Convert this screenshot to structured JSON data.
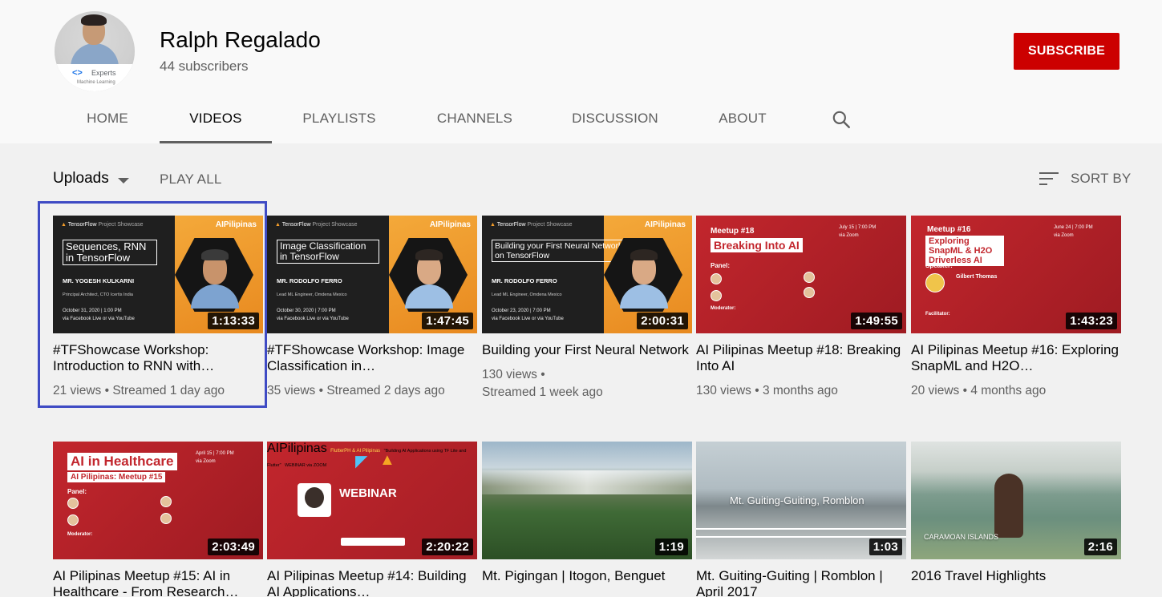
{
  "channel": {
    "name": "Ralph Regalado",
    "subscribers": "44 subscribers",
    "subscribe_label": "SUBSCRIBE",
    "avatar_badge": "Experts",
    "avatar_badge_sub": "Machine Learning"
  },
  "tabs": [
    {
      "label": "HOME"
    },
    {
      "label": "VIDEOS",
      "active": true
    },
    {
      "label": "PLAYLISTS"
    },
    {
      "label": "CHANNELS"
    },
    {
      "label": "DISCUSSION"
    },
    {
      "label": "ABOUT"
    }
  ],
  "toolbar": {
    "uploads_label": "Uploads",
    "play_all_label": "PLAY ALL",
    "sort_label": "SORT BY"
  },
  "videos": [
    {
      "title": "#TFShowcase Workshop: Introduction to RNN with…",
      "meta": "21 views • Streamed 1 day ago",
      "duration": "1:13:33",
      "thumb": {
        "title": "Sequences, RNN in TensorFlow",
        "speaker": "MR. YOGESH KULKARNI",
        "role": "Principal Architect, CTO Icertis India",
        "date": "October 31, 2020 | 1:00 PM",
        "via": "via Facebook Live or via YouTube"
      }
    },
    {
      "title": "#TFShowcase Workshop: Image Classification in…",
      "meta": "35 views • Streamed 2 days ago",
      "duration": "1:47:45",
      "thumb": {
        "title": "Image Classification in TensorFlow",
        "speaker": "MR. RODOLFO FERRO",
        "role": "Lead ML Engineer, Omdena Mexico",
        "date": "October 30, 2020 | 7:00 PM",
        "via": "via Facebook Live or via YouTube"
      }
    },
    {
      "title": "Building your First Neural Network",
      "meta": "130 views •",
      "meta2": "Streamed 1 week ago",
      "duration": "2:00:31",
      "thumb": {
        "title": "Building your First Neural Network on TensorFlow",
        "speaker": "MR. RODOLFO FERRO",
        "role": "Lead ML Engineer, Omdena Mexico",
        "date": "October 23, 2020 | 7:00 PM",
        "via": "via Facebook Live or via YouTube"
      }
    },
    {
      "title": "AI Pilipinas Meetup #18: Breaking Into AI",
      "meta": "130 views • 3 months ago",
      "duration": "1:49:55",
      "thumb": {
        "label": "Meetup #18",
        "title": "Breaking Into AI",
        "date": "July 15 | 7:00 PM",
        "via": "via Zoom",
        "panel": "Panel:",
        "moderator": "Moderator:"
      }
    },
    {
      "title": "AI Pilipinas Meetup #16: Exploring SnapML and H2O…",
      "meta": "20 views • 4 months ago",
      "duration": "1:43:23",
      "thumb": {
        "label": "Meetup #16",
        "title": "Exploring SnapML & H2O Driverless AI",
        "date": "June 24 | 7:00 PM",
        "via": "via Zoom",
        "speaker_label": "Speaker:",
        "speaker": "Gilbert Thomas",
        "facilitator": "Facilitator:"
      }
    },
    {
      "title": "AI Pilipinas Meetup #15: AI in Healthcare - From Research…",
      "meta": "",
      "duration": "2:03:49",
      "thumb": {
        "title": "AI in Healthcare",
        "subtitle": "AI Pilipinas: Meetup #15",
        "date": "April 15 | 7:00 PM",
        "via": "via Zoom",
        "panel": "Panel:",
        "moderator": "Moderator:"
      }
    },
    {
      "title": "AI Pilipinas Meetup #14: Building AI Applications…",
      "meta": "",
      "duration": "2:20:22",
      "thumb": {
        "label": "FlutterPH & AI Pilipinas",
        "title": "WEBINAR",
        "subtitle": "\"Building AI Applications using TF Lite and Flutter\"",
        "via": "WEBINAR via ZOOM"
      }
    },
    {
      "title": "Mt. Pigingan | Itogon, Benguet",
      "meta": "",
      "duration": "1:19"
    },
    {
      "title": "Mt. Guiting-Guiting | Romblon | April 2017",
      "meta": "",
      "duration": "1:03",
      "thumb": {
        "caption": "Mt. Guiting-Guiting, Romblon"
      }
    },
    {
      "title": "2016 Travel Highlights",
      "meta": "",
      "duration": "2:16",
      "thumb": {
        "caption": "CARAMOAN ISLANDS"
      }
    }
  ],
  "colors": {
    "subscribe": "#cc0000",
    "selection": "#3f4bc4",
    "tf_orange": "#f4a93a",
    "meetup_red": "#c2262d"
  },
  "icons": {
    "search": "magnifier",
    "sort": "sort-lines",
    "uploads_caret": "caret-down"
  }
}
